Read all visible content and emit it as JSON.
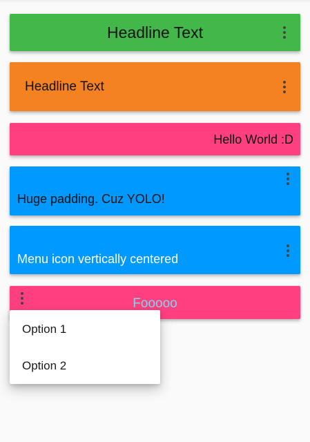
{
  "colors": {
    "green": "#43b84a",
    "orange": "#f58220",
    "pink": "#ff3f7f",
    "blue": "#0099ff",
    "text_on_pink_footer": "#7fd6f0"
  },
  "bars": [
    {
      "label": "Headline Text",
      "menu_icon": "more-vert-icon"
    },
    {
      "label": "Headline Text",
      "menu_icon": "more-vert-icon"
    },
    {
      "label": "Hello World :D"
    },
    {
      "label": "Huge padding. Cuz YOLO!",
      "menu_icon": "more-vert-icon"
    },
    {
      "label": "Menu icon vertically centered",
      "menu_icon": "more-vert-icon"
    },
    {
      "label": "Fooooo",
      "menu_icon": "more-vert-icon"
    }
  ],
  "popup_menu": {
    "items": [
      {
        "label": "Option 1"
      },
      {
        "label": "Option 2"
      }
    ]
  }
}
